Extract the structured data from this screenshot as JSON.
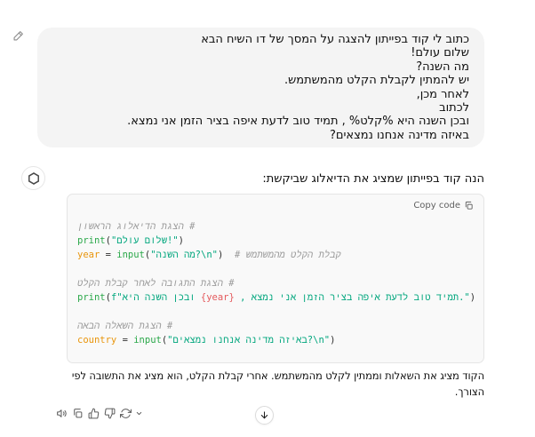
{
  "colors": {
    "bubble_bg": "#f4f4f4",
    "code_bg": "#f9f9f9",
    "code_border": "#e5e5e5",
    "comment": "#9b9b9b",
    "builtin": "#2ba84a",
    "string": "#00a67d",
    "variable": "#e9950c",
    "subst": "#e4595c",
    "plain": "#2f2f2f",
    "icon_gray": "#5d5d5d"
  },
  "user_message": {
    "lines": [
      "כתוב לי קוד בפייתון להצגה על המסך של דו השיח הבא",
      "שלום עולם!",
      "מה השנה?",
      "יש להמתין לקבלת הקלט מהמשתמש.",
      "לאחר מכן,",
      "לכתוב",
      "ובכן השנה היא %קלט% , תמיד טוב לדעת איפה בציר הזמן אני נמצא.",
      "באיזה מדינה אנחנו נמצאים?"
    ]
  },
  "assistant": {
    "intro": "הנה קוד בפייתון שמציג את הדיאלוג שביקשת:",
    "outro_lines": [
      "הקוד מציג את השאלות וממתין לקלט מהמשתמש. אחרי קבלת הקלט, הוא מציג את התשובה לפי",
      "הצורך."
    ]
  },
  "code_block": {
    "copy_button_label": "Copy code",
    "language": "python",
    "lines": [
      {
        "segments": [
          {
            "type": "comment",
            "text": "# הצגת הדיאלוג הראשון"
          }
        ]
      },
      {
        "segments": [
          {
            "type": "builtin",
            "text": "print"
          },
          {
            "type": "plain",
            "text": "("
          },
          {
            "type": "string",
            "text": "\"שלום עולם!\""
          },
          {
            "type": "plain",
            "text": ")"
          }
        ]
      },
      {
        "segments": [
          {
            "type": "variable",
            "text": "year"
          },
          {
            "type": "plain",
            "text": " = "
          },
          {
            "type": "builtin",
            "text": "input"
          },
          {
            "type": "plain",
            "text": "("
          },
          {
            "type": "string",
            "text": "\"מה השנה?\\n\""
          },
          {
            "type": "plain",
            "text": ")  "
          },
          {
            "type": "comment",
            "text": "# קבלת הקלט מהמשתמש"
          }
        ]
      },
      {
        "segments": []
      },
      {
        "segments": [
          {
            "type": "comment",
            "text": "# הצגת התגובה לאחר קבלת הקלט"
          }
        ]
      },
      {
        "segments": [
          {
            "type": "builtin",
            "text": "print"
          },
          {
            "type": "plain",
            "text": "("
          },
          {
            "type": "string",
            "text": "f\"ובכן השנה היא "
          },
          {
            "type": "subst",
            "text": "{year}"
          },
          {
            "type": "string",
            "text": " , תמיד טוב לדעת איפה בציר הזמן אני נמצא.\""
          },
          {
            "type": "plain",
            "text": ")"
          }
        ]
      },
      {
        "segments": []
      },
      {
        "segments": [
          {
            "type": "comment",
            "text": "# הצגת השאלה הבאה"
          }
        ]
      },
      {
        "segments": [
          {
            "type": "variable",
            "text": "country"
          },
          {
            "type": "plain",
            "text": " = "
          },
          {
            "type": "builtin",
            "text": "input"
          },
          {
            "type": "plain",
            "text": "("
          },
          {
            "type": "string",
            "text": "\"באיזה מדינה אנחנו נמצאים?\\n\""
          },
          {
            "type": "plain",
            "text": ")"
          }
        ]
      }
    ]
  },
  "action_bar": {
    "icons": [
      "read-aloud",
      "copy",
      "thumbs-up",
      "thumbs-down",
      "regenerate"
    ]
  }
}
